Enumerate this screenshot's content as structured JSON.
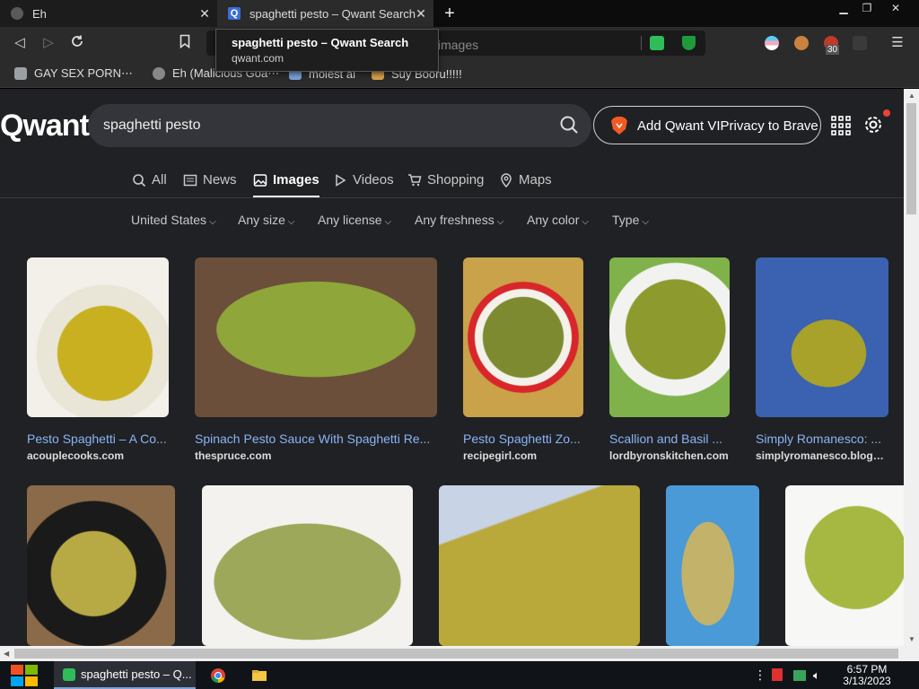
{
  "browser": {
    "tabs": [
      {
        "title": "Eh",
        "icon": "globe-icon"
      },
      {
        "title": "spaghetti pesto – Qwant Search",
        "icon": "qwant-favicon"
      }
    ],
    "address_placeholder": "images",
    "tooltip": {
      "title": "spaghetti pesto – Qwant Search",
      "url": "qwant.com"
    },
    "bookmarks": [
      {
        "label": "GAY SEX PORN⋯",
        "icon": "folder-icon"
      },
      {
        "label": "Eh (Malicious Goa⋯",
        "icon": "globe-icon"
      },
      {
        "label": "molest al",
        "icon": "page-icon"
      },
      {
        "label": "Suy Booru!!!!!",
        "icon": "page-icon"
      }
    ],
    "extension_badge": "30"
  },
  "qwant": {
    "logo": "Qwant",
    "query": "spaghetti pesto",
    "brave_button": "Add Qwant VIPrivacy to Brave",
    "tabs": [
      "All",
      "News",
      "Images",
      "Videos",
      "Shopping",
      "Maps"
    ],
    "active_tab": "Images",
    "filters": [
      "United States",
      "Any size",
      "Any license",
      "Any freshness",
      "Any color",
      "Type"
    ]
  },
  "results": [
    {
      "title": "Pesto Spaghetti – A Co...",
      "source": "acouplecooks.com"
    },
    {
      "title": "Spinach Pesto Sauce With Spaghetti Re...",
      "source": "thespruce.com"
    },
    {
      "title": "Pesto Spaghetti Zo...",
      "source": "recipegirl.com"
    },
    {
      "title": "Scallion and Basil ...",
      "source": "lordbyronskitchen.com"
    },
    {
      "title": "Simply Romanesco: ...",
      "source": "simplyromanesco.blogsp..."
    }
  ],
  "taskbar": {
    "active_task": "spaghetti pesto – Q...",
    "time": "6:57 PM",
    "date": "3/13/2023"
  },
  "colors": {
    "page_bg": "#202124",
    "link": "#8ab4f8",
    "pasta_green": "#9aa62a"
  }
}
